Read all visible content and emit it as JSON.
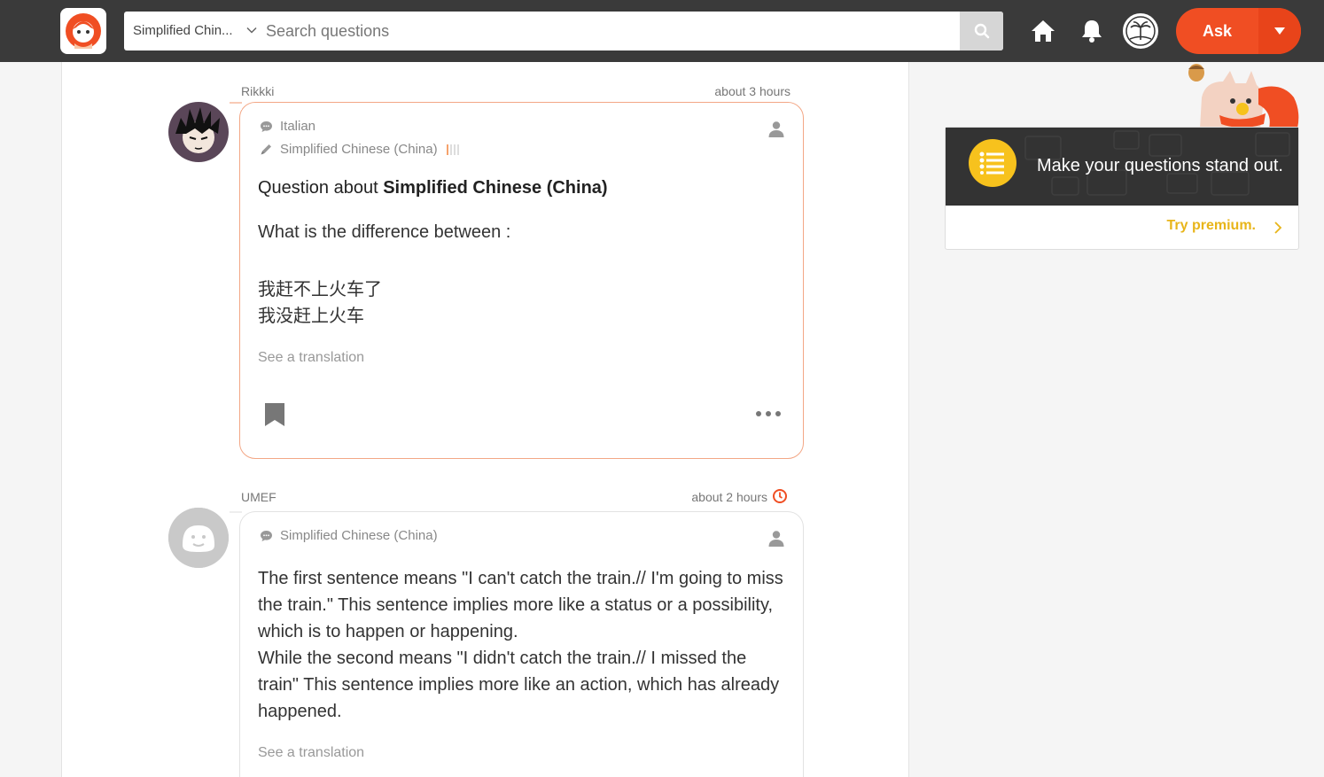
{
  "header": {
    "language_selected": "Simplified Chin...",
    "search_placeholder": "Search questions",
    "ask_label": "Ask"
  },
  "question": {
    "username": "Rikkki",
    "time": "about 3 hours",
    "native_language": "Italian",
    "learning_language": "Simplified Chinese (China)",
    "learning_level": 1,
    "title_prefix": "Question about ",
    "title_language": "Simplified Chinese (China)",
    "body_intro": "What is the difference between :",
    "sentence_1": "我赶不上火车了",
    "sentence_2": "我没赶上火车",
    "see_translation": "See a translation"
  },
  "answer": {
    "username": "UMEF",
    "time": "about 2 hours",
    "native_language": "Simplified Chinese (China)",
    "text_1": "The first sentence means \"I can't catch the train.// I'm going to miss the train.\" This sentence implies more like a status or a possibility, which is to happen or happening.",
    "text_2": "While the second means \"I didn't catch the train.// I missed the train\" This sentence implies more like an action, which has already happened.",
    "see_translation": "See a translation"
  },
  "promo": {
    "headline": "Make your questions stand out.",
    "link": "Try premium."
  },
  "colors": {
    "header_bg": "#3a3a3a",
    "brand_orange": "#f04e23",
    "question_border": "#f3a786",
    "premium_yellow": "#f7c21d"
  },
  "icons": [
    "logo-icon",
    "chevron-down-icon",
    "search-icon",
    "home-icon",
    "bell-icon",
    "user-avatar",
    "caret-down-icon",
    "speech-bubble-icon",
    "pencil-icon",
    "person-icon",
    "bookmark-icon",
    "more-dots-icon",
    "clock-icon",
    "list-icon",
    "chevron-right-icon"
  ]
}
